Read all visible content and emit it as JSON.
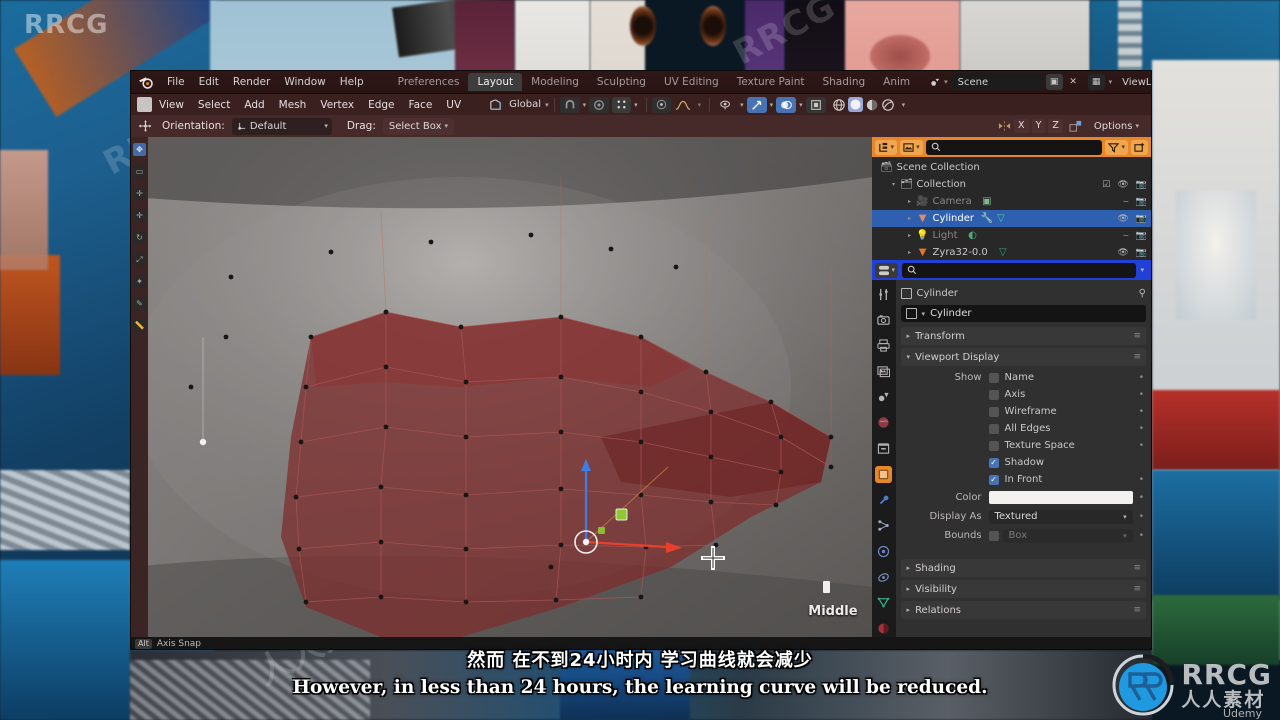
{
  "app": {
    "name": "Blender",
    "logo_icon": "blender-logo-icon"
  },
  "topbar": {
    "menus": [
      "File",
      "Edit",
      "Render",
      "Window",
      "Help"
    ],
    "workspace_tabs": [
      {
        "label": "Preferences",
        "active": false
      },
      {
        "label": "Layout",
        "active": true
      },
      {
        "label": "Modeling",
        "active": false
      },
      {
        "label": "Sculpting",
        "active": false
      },
      {
        "label": "UV Editing",
        "active": false
      },
      {
        "label": "Texture Paint",
        "active": false
      },
      {
        "label": "Shading",
        "active": false
      },
      {
        "label": "Anim",
        "active": false
      }
    ],
    "scene": {
      "icon": "scene-icon",
      "value": "Scene",
      "new_button_icon": "duplicate-icon",
      "unlink_button_icon": "close-icon"
    },
    "view_layer": {
      "icon": "view-layer-icon",
      "value": "ViewLayer",
      "new_button_icon": "duplicate-icon",
      "unlink_button_icon": "close-icon"
    }
  },
  "viewport_header": {
    "mode_icon": "edit-mode-icon",
    "menus": [
      "View",
      "Select",
      "Add",
      "Mesh",
      "Vertex",
      "Edge",
      "Face",
      "UV"
    ],
    "transform_orientation": {
      "icon": "orientation-icon",
      "value": "Global"
    },
    "snap": {
      "icon": "magnet-icon",
      "enabled": false
    },
    "proportional_edit": {
      "icon": "proportional-icon",
      "enabled": false
    },
    "falloff": {
      "icon": "smooth-falloff-icon"
    },
    "mesh_select_modes": [
      "vertex-select-icon",
      "edge-select-icon",
      "face-select-icon"
    ],
    "visibility": {
      "icon": "eye-dropdown-icon"
    },
    "gizmo": {
      "icon": "gizmo-icon",
      "enabled": true
    },
    "overlays": {
      "icon": "overlays-icon",
      "enabled": true
    },
    "xray": {
      "icon": "xray-icon",
      "enabled": false
    },
    "shading_modes": [
      "wireframe-icon",
      "solid-icon",
      "material-preview-icon",
      "rendered-icon"
    ],
    "shading_active_index": 1
  },
  "tool_settings": {
    "tool_icon": "tweak-tool-icon",
    "orientation_label": "Orientation:",
    "orientation_value": "Default",
    "orientation_icon": "default-orientation-icon",
    "drag_label": "Drag:",
    "drag_value": "Select Box",
    "mirror_icon": "mirror-icon",
    "axes": [
      "X",
      "Y",
      "Z"
    ],
    "snap_icon": "snap-icon",
    "options_label": "Options"
  },
  "outliner": {
    "display_mode_icon": "outliner-display-mode-icon",
    "filter_id_icon": "id-type-icon",
    "search_placeholder": "",
    "search_icon": "search-icon",
    "filter_icon": "funnel-icon",
    "new_collection_icon": "new-collection-icon",
    "rows": [
      {
        "label": "Scene Collection",
        "icon": "scene-collection-icon",
        "indent": 0,
        "twisty": "",
        "selected": false,
        "dim": false,
        "right_icons": []
      },
      {
        "label": "Collection",
        "icon": "collection-icon",
        "indent": 1,
        "twisty": "▾",
        "selected": false,
        "dim": false,
        "right_icons": [
          "checkbox-icon",
          "eye-icon",
          "camera-icon"
        ]
      },
      {
        "label": "Camera",
        "icon": "camera-object-icon",
        "indent": 2,
        "twisty": "▸",
        "selected": false,
        "dim": true,
        "right_icons": [
          "hidden-eye-icon",
          "camera-icon"
        ]
      },
      {
        "label": "Cylinder",
        "icon": "mesh-object-icon",
        "indent": 2,
        "twisty": "▸",
        "selected": true,
        "dim": false,
        "right_icons": [
          "eye-icon",
          "camera-icon"
        ]
      },
      {
        "label": "Light",
        "icon": "light-object-icon",
        "indent": 2,
        "twisty": "▸",
        "selected": false,
        "dim": true,
        "right_icons": [
          "hidden-eye-icon",
          "camera-icon"
        ]
      },
      {
        "label": "Zyra32-0.0",
        "icon": "mesh-object-icon",
        "indent": 2,
        "twisty": "▸",
        "selected": false,
        "dim": false,
        "right_icons": [
          "eye-icon",
          "camera-icon"
        ]
      }
    ]
  },
  "properties": {
    "editor_type_icon": "properties-editor-icon",
    "search_placeholder": "",
    "search_icon": "search-icon",
    "tabs": [
      {
        "name": "tool",
        "icon": "tool-icon",
        "active": false
      },
      {
        "name": "render",
        "icon": "render-icon",
        "active": false
      },
      {
        "name": "output",
        "icon": "printer-icon",
        "active": false
      },
      {
        "name": "view-layer",
        "icon": "images-icon",
        "active": false
      },
      {
        "name": "scene",
        "icon": "scene-props-icon",
        "active": false
      },
      {
        "name": "world",
        "icon": "world-icon",
        "active": false
      },
      {
        "name": "collection",
        "icon": "collection-props-icon",
        "active": false
      },
      {
        "name": "object",
        "icon": "object-props-icon",
        "active": true
      },
      {
        "name": "modifiers",
        "icon": "wrench-icon",
        "active": false
      },
      {
        "name": "particles",
        "icon": "particles-icon",
        "active": false
      },
      {
        "name": "physics",
        "icon": "physics-icon",
        "active": false
      },
      {
        "name": "constraints",
        "icon": "constraints-icon",
        "active": false
      },
      {
        "name": "object-data",
        "icon": "mesh-data-icon",
        "active": false
      },
      {
        "name": "material",
        "icon": "material-icon",
        "active": false
      }
    ],
    "breadcrumb_object": "Cylinder",
    "name_field_value": "Cylinder",
    "panels": [
      {
        "label": "Transform",
        "open": false
      },
      {
        "label": "Viewport Display",
        "open": true
      },
      {
        "label": "Shading",
        "open": false
      },
      {
        "label": "Visibility",
        "open": false
      },
      {
        "label": "Relations",
        "open": false
      }
    ],
    "viewport_display": {
      "show_label": "Show",
      "checkboxes": [
        {
          "label": "Name",
          "checked": false
        },
        {
          "label": "Axis",
          "checked": false
        },
        {
          "label": "Wireframe",
          "checked": false
        },
        {
          "label": "All Edges",
          "checked": false
        },
        {
          "label": "Texture Space",
          "checked": false
        },
        {
          "label": "Shadow",
          "checked": true
        },
        {
          "label": "In Front",
          "checked": true
        }
      ],
      "color_label": "Color",
      "color_value": "#FFFFFF",
      "display_as_label": "Display As",
      "display_as_value": "Textured",
      "bounds_label": "Bounds",
      "bounds_value": "Box",
      "bounds_enabled": false
    }
  },
  "status_bar": {
    "key": "Alt",
    "action": "Axis Snap"
  },
  "viewport_overlay": {
    "mouse_hint_icon": "mouse-middle-button-icon",
    "middle_label": "Middle",
    "gizmo_axes": {
      "x_color": "#e8402a",
      "y_color": "#7ab81e",
      "z_color": "#3e7ee8"
    },
    "cursor_icon": "crosshair-icon"
  },
  "subtitles": {
    "chinese": "然而 在不到24小时内 学习曲线就会减少",
    "english": "However, in less than 24 hours, the learning curve will be reduced."
  },
  "watermarks": {
    "brand": "RRCG",
    "brand_cn": "人人素材",
    "platform": "Udemy"
  },
  "theme": {
    "accent_orange": "#e8862a",
    "accent_blue": "#2040d8",
    "select_blue": "#2f5faf",
    "header_maroon": "#462929",
    "panel_bg": "#303030"
  }
}
